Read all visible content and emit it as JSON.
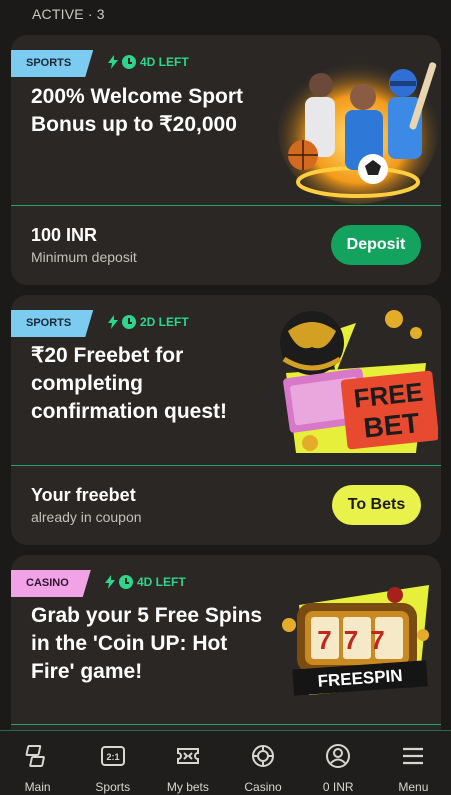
{
  "header": {
    "active_label": "ACTIVE · 3"
  },
  "cards": [
    {
      "tag": "SPORTS",
      "timer": "4D LEFT",
      "title": "200% Welcome Sport Bonus up to ₹20,000",
      "footer_main": "100 INR",
      "footer_sub": "Minimum deposit",
      "button": "Deposit"
    },
    {
      "tag": "SPORTS",
      "timer": "2D LEFT",
      "title": "₹20 Freebet for completing confirmation quest!",
      "footer_main": "Your freebet",
      "footer_sub": "already in coupon",
      "button": "To Bets",
      "art_text_1": "FREE",
      "art_text_2": "BET"
    },
    {
      "tag": "CASINO",
      "timer": "4D LEFT",
      "title": "Grab your 5 Free Spins in the 'Coin UP: Hot Fire' game!",
      "art_text": "FREESPIN",
      "art_reels": "777"
    }
  ],
  "nav": [
    {
      "label": "Main",
      "icon": "main-icon"
    },
    {
      "label": "Sports",
      "icon": "sports-icon",
      "icon_text": "2:1"
    },
    {
      "label": "My bets",
      "icon": "ticket-icon"
    },
    {
      "label": "Casino",
      "icon": "casino-chip-icon"
    },
    {
      "label": "0 INR",
      "icon": "user-icon"
    },
    {
      "label": "Menu",
      "icon": "menu-icon"
    }
  ],
  "colors": {
    "background": "#1b1a18",
    "card": "#2a2724",
    "accent_green": "#14a35f",
    "timer_green": "#2fd58a",
    "sports_tag": "#7ccbf0",
    "casino_tag": "#f2a2e6",
    "yellow_button": "#e8f24a"
  }
}
